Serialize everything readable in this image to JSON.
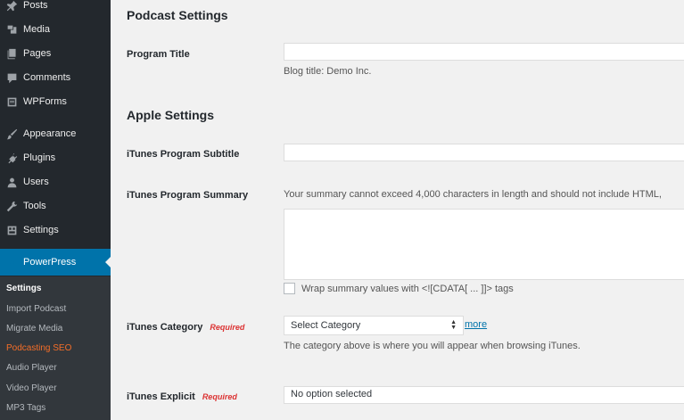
{
  "sidebar": {
    "items": [
      {
        "label": "Posts",
        "icon": "pin-icon"
      },
      {
        "label": "Media",
        "icon": "media-icon"
      },
      {
        "label": "Pages",
        "icon": "pages-icon"
      },
      {
        "label": "Comments",
        "icon": "comment-icon"
      },
      {
        "label": "WPForms",
        "icon": "wpforms-icon"
      },
      {
        "label": "Appearance",
        "icon": "brush-icon"
      },
      {
        "label": "Plugins",
        "icon": "plugin-icon"
      },
      {
        "label": "Users",
        "icon": "user-icon"
      },
      {
        "label": "Tools",
        "icon": "wrench-icon"
      },
      {
        "label": "Settings",
        "icon": "settings-icon"
      }
    ],
    "active": {
      "label": "PowerPress",
      "icon": "powerpress-icon"
    },
    "submenu": [
      "Settings",
      "Import Podcast",
      "Migrate Media",
      "Podcasting SEO",
      "Audio Player",
      "Video Player",
      "MP3 Tags"
    ]
  },
  "main": {
    "podcast_settings_title": "Podcast Settings",
    "program_title_label": "Program Title",
    "program_title_value": "",
    "program_title_desc": "Blog title: Demo Inc.",
    "apple_settings_title": "Apple Settings",
    "subtitle_label": "iTunes Program Subtitle",
    "subtitle_value": "",
    "summary_label": "iTunes Program Summary",
    "summary_desc": "Your summary cannot exceed 4,000 characters in length and should not include HTML,",
    "wrap_label": "Wrap summary values with <![CDATA[ ... ]]> tags",
    "category_label": "iTunes Category",
    "required": "Required",
    "category_value": "Select Category",
    "more_link": "more",
    "category_desc": "The category above is where you will appear when browsing iTunes.",
    "explicit_label": "iTunes Explicit",
    "explicit_value": "No option selected"
  },
  "colors": {
    "sidebar_bg": "#23282d",
    "submenu_bg": "#32373c",
    "active_bg": "#0073aa",
    "current_submenu": "#f56e28",
    "required": "#dc3232",
    "link": "#0073aa"
  }
}
